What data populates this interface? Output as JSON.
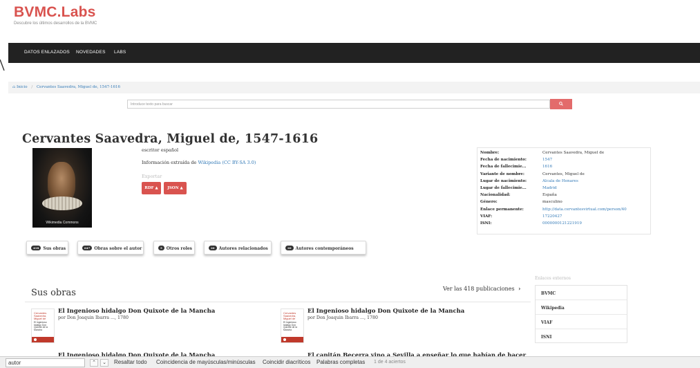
{
  "brand": {
    "title": "BVMC.Labs",
    "subtitle": "Descubre los últimos desarrollos de la BVMC"
  },
  "nav": {
    "items": [
      "DATOS ENLAZADOS",
      "NOVEDADES",
      "LABS"
    ]
  },
  "breadcrumb": {
    "home": "Inicio",
    "current": "Cervantes Saavedra, Miguel de, 1547-1616"
  },
  "search": {
    "placeholder": "Introduce texto para buscar",
    "button_icon": "search-icon"
  },
  "author": {
    "title": "Cervantes Saavedra, Miguel de, 1547-1616",
    "image_caption": "Wikimedia Commons",
    "occupation": "escritor español",
    "info_prefix": "Información extraída de",
    "info_link": "Wikipedia (CC BY-SA 3.0)",
    "export_label": "Exportar",
    "export_buttons": [
      "RDF",
      "JSON"
    ]
  },
  "info": [
    {
      "label": "Nombre:",
      "value": "Cervantes Saavedra, Miguel de",
      "link": false
    },
    {
      "label": "Fecha de nacimiento:",
      "value": "1547",
      "link": true
    },
    {
      "label": "Fecha de fallecimie...",
      "value": "1616",
      "link": true
    },
    {
      "label": "Variante de nombre:",
      "value": "Cervantes, Miguel de",
      "link": false
    },
    {
      "label": "Lugar de nacimiento:",
      "value": "Alcala de Henares",
      "link": true
    },
    {
      "label": "Lugar de fallecimie...",
      "value": "Madrid",
      "link": true
    },
    {
      "label": "Nacionalidad:",
      "value": "España",
      "link": false
    },
    {
      "label": "Género:",
      "value": "masculino",
      "link": false
    },
    {
      "label": "Enlace permanente:",
      "value": "http://data.cervantesvirtual.com/person/40",
      "link": true
    },
    {
      "label": "VIAF:",
      "value": "17220427",
      "link": true
    },
    {
      "label": "ISNI:",
      "value": "0000000121221919",
      "link": true
    }
  ],
  "tabs": [
    {
      "badge": "418",
      "label": "Sus obras"
    },
    {
      "badge": "647",
      "label": "Obras sobre el autor"
    },
    {
      "badge": "5",
      "label": "Otros roles"
    },
    {
      "badge": "20",
      "label": "Autores relacionados"
    },
    {
      "badge": "20",
      "label": "Autores contemporáneos"
    }
  ],
  "works": {
    "title": "Sus obras",
    "see_all": "Ver las 418 publicaciones",
    "items": [
      {
        "title": "El Ingenioso hidalgo Don Quixote de la Mancha",
        "author": "por Don Joaquin Ibarra ..., 1780",
        "thumb_red": "Cervantes Saavedra, Miguel de",
        "thumb_dark": "El Ingenioso hidalgo Don Quixote de la Mancha"
      },
      {
        "title": "El Ingenioso hidalgo Don Quixote de la Mancha",
        "author": "por Don Joaquin Ibarra ..., 1780",
        "thumb_red": "Cervantes Saavedra, Miguel de",
        "thumb_dark": "El Ingenioso hidalgo Don Quixote de la Mancha"
      },
      {
        "title": "El Ingenioso hidalgo Don Quixote de la Mancha",
        "author": "",
        "thumb_red": "",
        "thumb_dark": ""
      },
      {
        "title": "El capitán Becerra vino a Sevilla a enseñar lo que habían de hacer",
        "author": "",
        "thumb_red": "",
        "thumb_dark": ""
      }
    ]
  },
  "external": {
    "label": "Enlaces externos",
    "items": [
      "BVMC",
      "Wikipedia",
      "VIAF",
      "ISNI"
    ]
  },
  "findbar": {
    "query": "autor",
    "options": [
      "Resaltar todo",
      "Coincidencia de mayúsculas/minúsculas",
      "Coincidir diacríticos",
      "Palabras completas"
    ],
    "count": "1 de 4 aciertos"
  },
  "colors": {
    "accent": "#d9534f",
    "navbar": "#222222",
    "link": "#337ab7"
  }
}
